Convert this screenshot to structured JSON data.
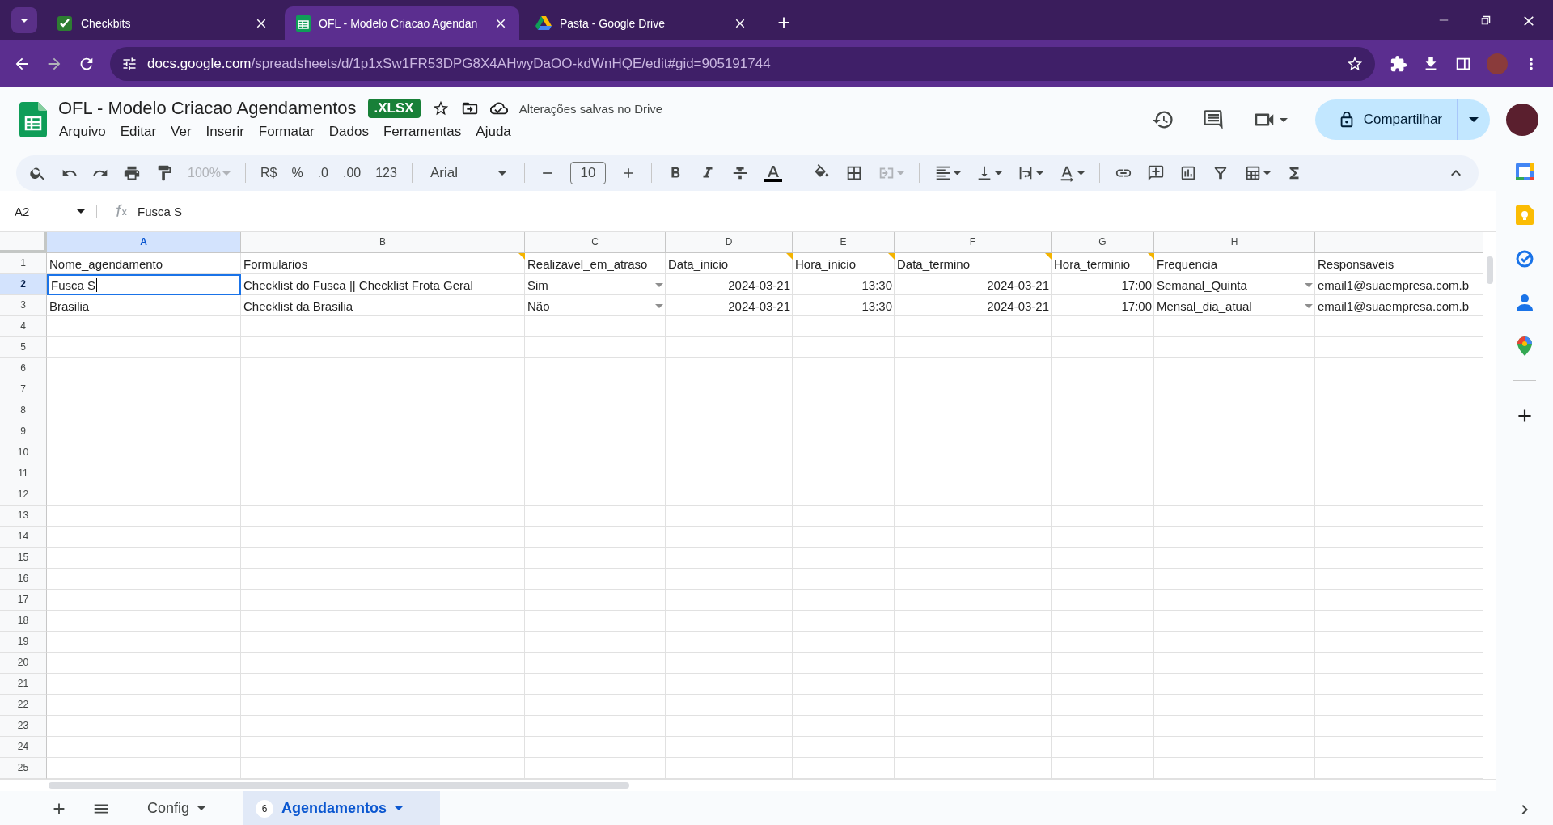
{
  "browser": {
    "tabs": [
      {
        "title": "Checkbits",
        "selected": false
      },
      {
        "title": "OFL - Modelo Criacao Agendan",
        "selected": true
      },
      {
        "title": "Pasta - Google Drive",
        "selected": false
      }
    ],
    "url_host": "docs.google.com",
    "url_path": "/spreadsheets/d/1p1xSw1FR53DPG8X4AHwyDaOO-kdWnHQE/edit#gid=905191744"
  },
  "document": {
    "title": "OFL - Modelo Criacao Agendamentos",
    "format_badge": ".XLSX",
    "save_status": "Alterações salvas no Drive"
  },
  "menu": [
    "Arquivo",
    "Editar",
    "Ver",
    "Inserir",
    "Formatar",
    "Dados",
    "Ferramentas",
    "Ajuda"
  ],
  "toolbar": {
    "zoom": "100%",
    "currency": "R$",
    "percent": "%",
    "decrease_decimals": ".0",
    "increase_decimals": ".00",
    "number_format": "123",
    "font": "Arial",
    "font_size": "10"
  },
  "share_button": "Compartilhar",
  "formula_bar": {
    "cell_ref": "A2",
    "content": "Fusca S"
  },
  "columns": [
    {
      "label": "A",
      "selected": true
    },
    {
      "label": "B",
      "selected": false
    },
    {
      "label": "C",
      "selected": false
    },
    {
      "label": "D",
      "selected": false
    },
    {
      "label": "E",
      "selected": false
    },
    {
      "label": "F",
      "selected": false
    },
    {
      "label": "G",
      "selected": false
    },
    {
      "label": "H",
      "selected": false
    }
  ],
  "rows": [
    {
      "number": "1",
      "selected": false,
      "cells": [
        {
          "text": "Nome_agendamento",
          "kind": "text",
          "note": false
        },
        {
          "text": "Formularios",
          "kind": "text",
          "note": true
        },
        {
          "text": "Realizavel_em_atraso",
          "kind": "text",
          "note": false
        },
        {
          "text": "Data_inicio",
          "kind": "text",
          "note": true
        },
        {
          "text": "Hora_inicio",
          "kind": "text",
          "note": true
        },
        {
          "text": "Data_termino",
          "kind": "text",
          "note": true
        },
        {
          "text": "Hora_terminio",
          "kind": "text",
          "note": true
        },
        {
          "text": "Frequencia",
          "kind": "text",
          "note": false
        },
        {
          "text": "Responsaveis",
          "kind": "text",
          "note": false
        }
      ]
    },
    {
      "number": "2",
      "selected": true,
      "cells": [
        {
          "text": "Fusca S",
          "kind": "text",
          "editing": true
        },
        {
          "text": "Checklist do Fusca || Checklist Frota Geral",
          "kind": "text"
        },
        {
          "text": "Sim",
          "kind": "dropdown"
        },
        {
          "text": "2024-03-21",
          "kind": "number"
        },
        {
          "text": "13:30",
          "kind": "number"
        },
        {
          "text": "2024-03-21",
          "kind": "number"
        },
        {
          "text": "17:00",
          "kind": "number"
        },
        {
          "text": "Semanal_Quinta",
          "kind": "dropdown"
        },
        {
          "text": "email1@suaempresa.com.b",
          "kind": "text"
        }
      ]
    },
    {
      "number": "3",
      "selected": false,
      "cells": [
        {
          "text": "Brasilia",
          "kind": "text",
          "editing": false
        },
        {
          "text": "Checklist da Brasilia",
          "kind": "text"
        },
        {
          "text": "Não",
          "kind": "dropdown"
        },
        {
          "text": "2024-03-21",
          "kind": "number"
        },
        {
          "text": "13:30",
          "kind": "number"
        },
        {
          "text": "2024-03-21",
          "kind": "number"
        },
        {
          "text": "17:00",
          "kind": "number"
        },
        {
          "text": "Mensal_dia_atual",
          "kind": "dropdown"
        },
        {
          "text": "email1@suaempresa.com.b",
          "kind": "text"
        }
      ]
    },
    {
      "number": "4",
      "selected": false
    },
    {
      "number": "5",
      "selected": false
    },
    {
      "number": "6",
      "selected": false
    },
    {
      "number": "7",
      "selected": false
    },
    {
      "number": "8",
      "selected": false
    },
    {
      "number": "9",
      "selected": false
    },
    {
      "number": "10",
      "selected": false
    },
    {
      "number": "11",
      "selected": false
    },
    {
      "number": "12",
      "selected": false
    },
    {
      "number": "13",
      "selected": false
    },
    {
      "number": "14",
      "selected": false
    },
    {
      "number": "15",
      "selected": false
    },
    {
      "number": "16",
      "selected": false
    },
    {
      "number": "17",
      "selected": false
    },
    {
      "number": "18",
      "selected": false
    },
    {
      "number": "19",
      "selected": false
    },
    {
      "number": "20",
      "selected": false
    },
    {
      "number": "21",
      "selected": false
    },
    {
      "number": "22",
      "selected": false
    },
    {
      "number": "23",
      "selected": false
    },
    {
      "number": "24",
      "selected": false
    },
    {
      "number": "25",
      "selected": false
    }
  ],
  "sheet_tabs": [
    {
      "label": "Config",
      "selected": false
    },
    {
      "label": "Agendamentos",
      "selected": true,
      "badge": "6"
    }
  ]
}
